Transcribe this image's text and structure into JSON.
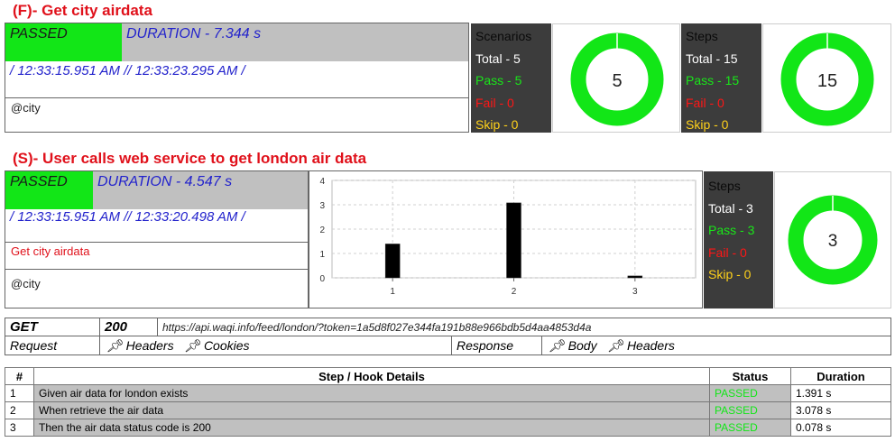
{
  "feature": {
    "title": "(F)- Get city airdata",
    "status": "PASSED",
    "duration": "DURATION - 7.344 s",
    "times": "/ 12:33:15.951 AM // 12:33:23.295 AM /",
    "tag": "@city",
    "scenarios": {
      "header": "Scenarios",
      "total": "Total - 5",
      "pass": "Pass - 5",
      "fail": "Fail - 0",
      "skip": "Skip - 0",
      "donut_value": "5"
    },
    "steps": {
      "header": "Steps",
      "total": "Total - 15",
      "pass": "Pass - 15",
      "fail": "Fail - 0",
      "skip": "Skip - 0",
      "donut_value": "15"
    }
  },
  "scenario": {
    "title": "(S)- User calls web service to get london air data",
    "status": "PASSED",
    "duration": "DURATION - 4.547 s",
    "times": "/ 12:33:15.951 AM // 12:33:20.498 AM /",
    "feature_link": "Get city airdata",
    "tag": "@city",
    "steps": {
      "header": "Steps",
      "total": "Total - 3",
      "pass": "Pass - 3",
      "fail": "Fail - 0",
      "skip": "Skip - 0",
      "donut_value": "3"
    }
  },
  "chart_data": {
    "type": "bar",
    "categories": [
      "1",
      "2",
      "3"
    ],
    "values": [
      1.391,
      3.078,
      0.078
    ],
    "ylim": [
      0,
      4
    ],
    "yticks": [
      "0",
      "1",
      "2",
      "3",
      "4"
    ],
    "grid": true
  },
  "request": {
    "method": "GET",
    "code": "200",
    "url": "https://api.waqi.info/feed/london/?token=1a5d8f027e344fa191b88e966bdb5d4aa4853d4a",
    "request_label": "Request",
    "req_headers": "Headers",
    "req_cookies": "Cookies",
    "response_label": "Response",
    "resp_body": "Body",
    "resp_headers": "Headers"
  },
  "step_table": {
    "headers": [
      "#",
      "Step / Hook Details",
      "Status",
      "Duration"
    ],
    "rows": [
      {
        "num": "1",
        "detail": "Given air data for london exists",
        "status": "PASSED",
        "duration": "1.391 s"
      },
      {
        "num": "2",
        "detail": "When retrieve the air data",
        "status": "PASSED",
        "duration": "3.078 s"
      },
      {
        "num": "3",
        "detail": "Then the air data status code is 200",
        "status": "PASSED",
        "duration": "0.078 s"
      }
    ]
  },
  "colors": {
    "pass": "#12e617",
    "fail": "#ff1616",
    "skip": "#ffd11a",
    "title": "#e0111b",
    "duration": "#2222cc"
  },
  "icons": {
    "pin": "pushpin-icon"
  }
}
